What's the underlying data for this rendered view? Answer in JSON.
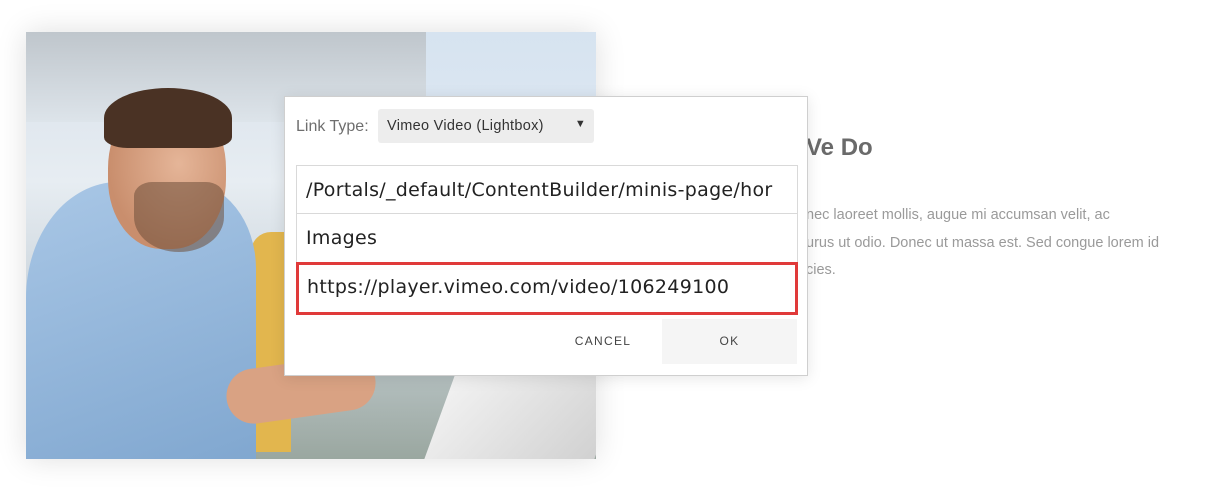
{
  "background_section": {
    "heading": "Ve Do",
    "body_lines": [
      "nec laoreet mollis, augue mi accumsan velit, ac",
      "urus ut odio. Donec ut massa est. Sed congue lorem id",
      "cies."
    ]
  },
  "dialog": {
    "link_type_label": "Link Type:",
    "link_type_value": "Vimeo Video (Lightbox)",
    "image_url": "/Portals/_default/ContentBuilder/minis-page/hor",
    "title_value": "Images",
    "link_value": "https://player.vimeo.com/video/106249100",
    "cancel_label": "CANCEL",
    "ok_label": "OK"
  },
  "colors": {
    "highlight_border": "#e03a3a",
    "dialog_border": "#cfcfcf",
    "ok_button_bg": "#f5f5f5"
  },
  "icons": {
    "select_caret": "caret-down-icon"
  }
}
